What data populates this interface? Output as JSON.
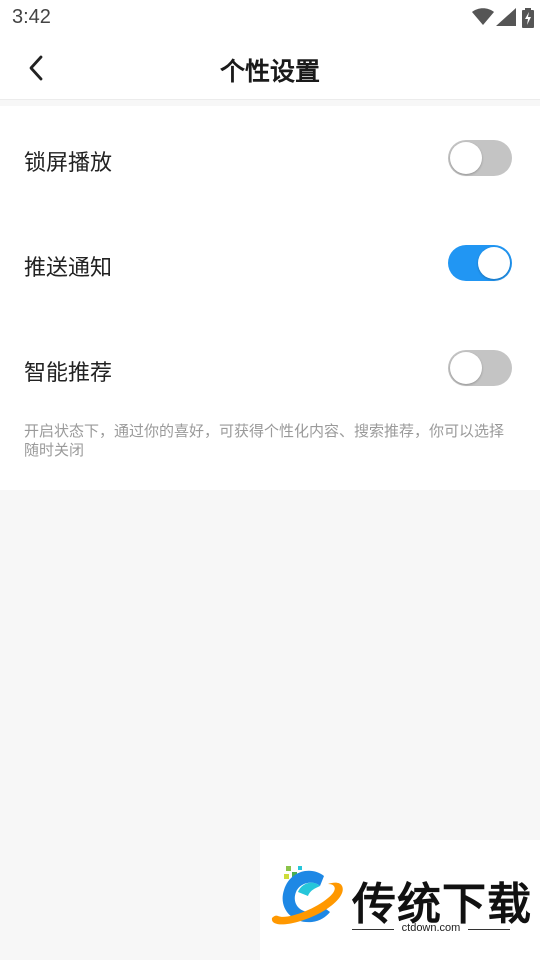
{
  "status_bar": {
    "time": "3:42",
    "icons": [
      "wifi-icon",
      "signal-icon",
      "battery-charging-icon"
    ]
  },
  "header": {
    "back_icon": "chevron-left-icon",
    "title": "个性设置"
  },
  "settings": {
    "items": [
      {
        "label": "锁屏播放",
        "enabled": false
      },
      {
        "label": "推送通知",
        "enabled": true
      },
      {
        "label": "智能推荐",
        "enabled": false
      }
    ],
    "note": "开启状态下，通过你的喜好，可获得个性化内容、搜索推荐，你可以选择随时关闭"
  },
  "colors": {
    "toggle_on": "#2196f3",
    "toggle_off": "#c4c4c4",
    "page_background": "#f7f7f7"
  },
  "watermark": {
    "brand": "传统下载",
    "domain": "ctdown.com"
  }
}
